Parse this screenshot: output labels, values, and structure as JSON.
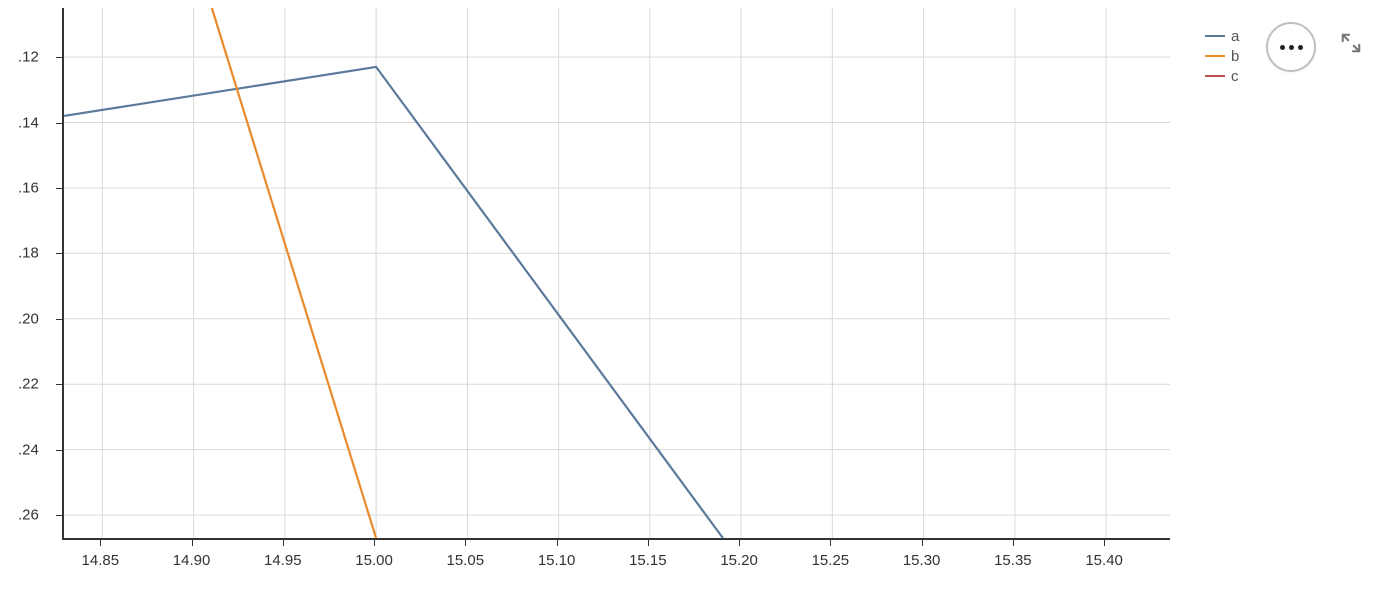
{
  "chart_data": {
    "type": "line",
    "title": "",
    "xlabel": "",
    "ylabel": "",
    "xlim": [
      14.829,
      15.435
    ],
    "ylim": [
      0.267,
      0.105
    ],
    "x_ticks": [
      14.85,
      14.9,
      14.95,
      15.0,
      15.05,
      15.1,
      15.15,
      15.2,
      15.25,
      15.3,
      15.35,
      15.4
    ],
    "x_tick_labels": [
      "14.85",
      "14.90",
      "14.95",
      "15.00",
      "15.05",
      "15.10",
      "15.15",
      "15.20",
      "15.25",
      "15.30",
      "15.35",
      "15.40"
    ],
    "y_ticks": [
      0.12,
      0.14,
      0.16,
      0.18,
      0.2,
      0.22,
      0.24,
      0.26
    ],
    "y_tick_labels": [
      ".12",
      ".14",
      ".16",
      ".18",
      ".20",
      ".22",
      ".24",
      ".26"
    ],
    "series": [
      {
        "name": "a",
        "color": "#5b7a9b",
        "x": [
          14.829,
          15.0,
          15.19
        ],
        "y": [
          0.138,
          0.123,
          0.267
        ]
      },
      {
        "name": "b",
        "color": "#e98b2a",
        "x": [
          14.91,
          15.0
        ],
        "y": [
          0.105,
          0.267
        ]
      },
      {
        "name": "c",
        "color": "#c0504d",
        "x": [],
        "y": []
      }
    ],
    "legend": {
      "items": [
        {
          "label": "a",
          "color": "#5b7a9b"
        },
        {
          "label": "b",
          "color": "#e98b2a"
        },
        {
          "label": "c",
          "color": "#c0504d"
        }
      ]
    }
  },
  "toolbar": {
    "more_tooltip": "More options",
    "expand_tooltip": "Expand"
  }
}
